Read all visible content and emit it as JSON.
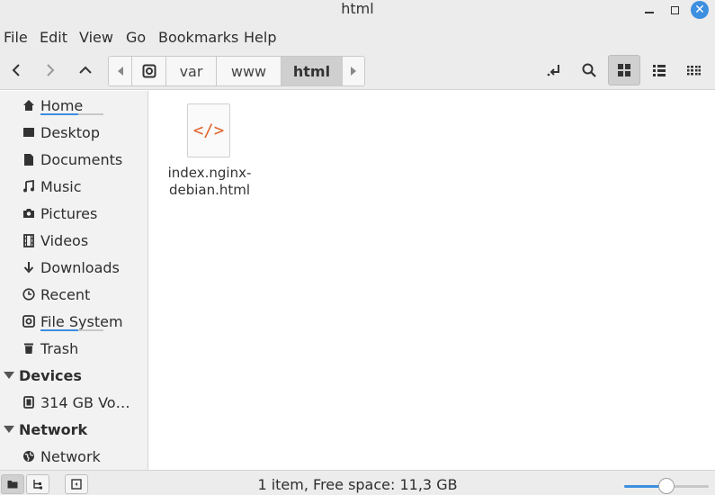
{
  "window": {
    "title": "html"
  },
  "menu": {
    "items": [
      "File",
      "Edit",
      "View",
      "Go",
      "Bookmarks",
      "Help"
    ]
  },
  "pathbar": {
    "segments": [
      "var",
      "www",
      "html"
    ],
    "active_index": 2
  },
  "sidebar": {
    "places": [
      {
        "label": "Home",
        "icon": "home-icon",
        "usage": 0.6
      },
      {
        "label": "Desktop",
        "icon": "desktop-icon"
      },
      {
        "label": "Documents",
        "icon": "documents-icon"
      },
      {
        "label": "Music",
        "icon": "music-icon"
      },
      {
        "label": "Pictures",
        "icon": "camera-icon"
      },
      {
        "label": "Videos",
        "icon": "film-icon"
      },
      {
        "label": "Downloads",
        "icon": "download-arrow-icon"
      },
      {
        "label": "Recent",
        "icon": "clock-icon"
      },
      {
        "label": "File System",
        "icon": "drive-icon",
        "usage": 0.6
      },
      {
        "label": "Trash",
        "icon": "trash-icon"
      }
    ],
    "devices_label": "Devices",
    "devices": [
      {
        "label": "314 GB Vo…",
        "icon": "disk-icon"
      }
    ],
    "network_label": "Network",
    "network": [
      {
        "label": "Network",
        "icon": "globe-icon"
      }
    ]
  },
  "content": {
    "files": [
      {
        "name": "index.nginx-debian.html",
        "name_line1": "index.nginx-",
        "name_line2": "debian.html",
        "icon": "html-file-icon",
        "glyph": "</>"
      }
    ]
  },
  "status": {
    "text": "1 item, Free space: 11,3 GB",
    "zoom_level": 0.5
  },
  "colors": {
    "accent": "#3d8fe0",
    "html_glyph": "#e0642a"
  }
}
